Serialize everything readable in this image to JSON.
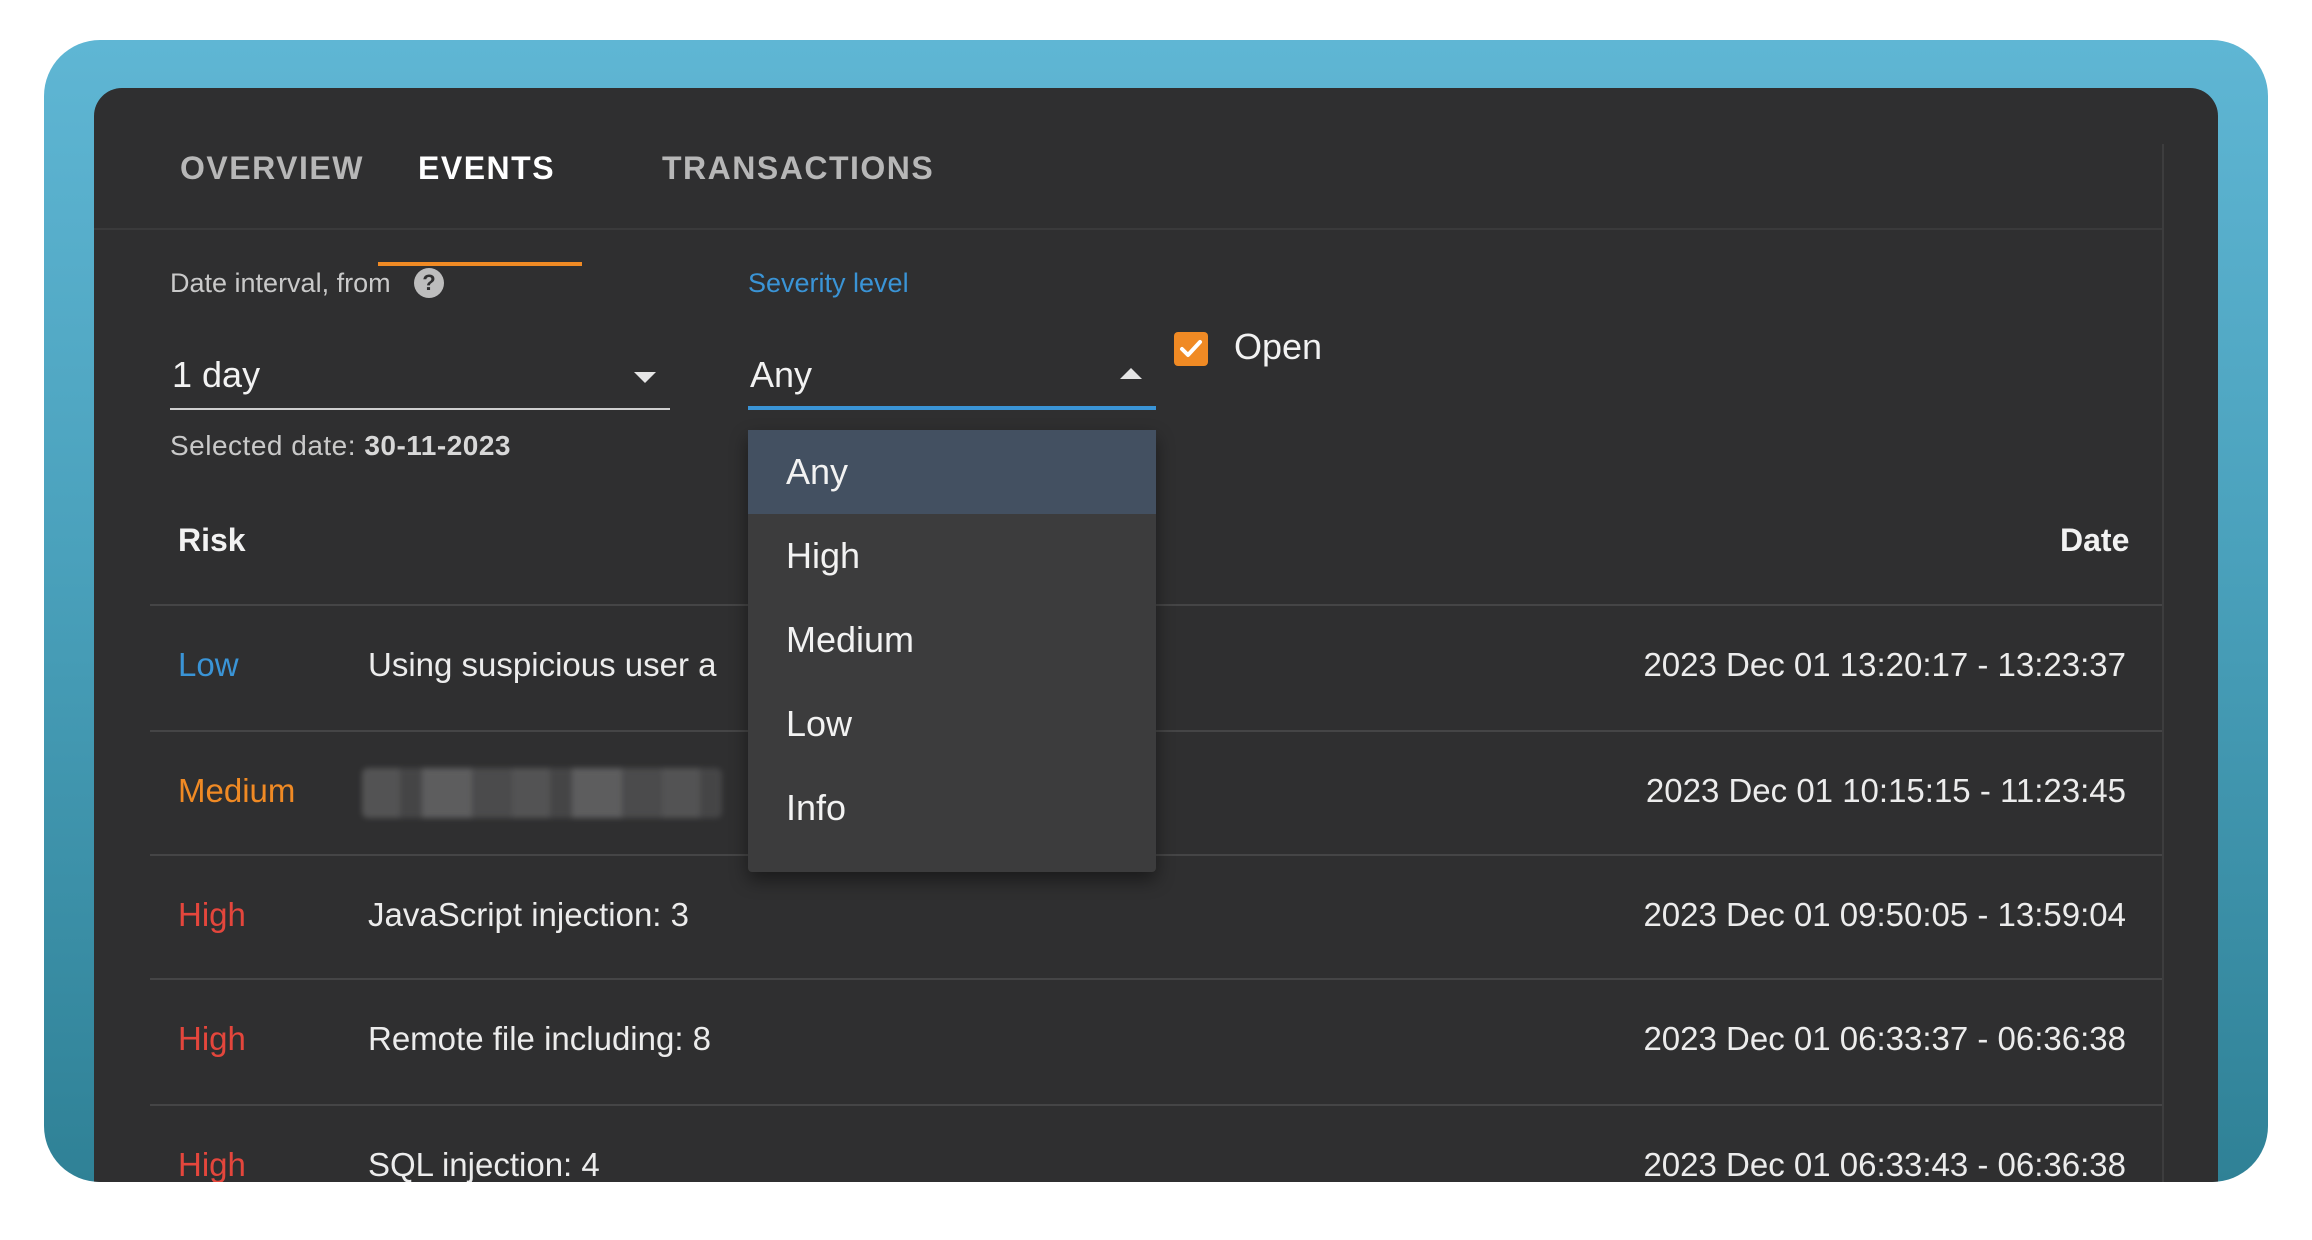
{
  "tabs": [
    {
      "label": "OVERVIEW",
      "active": false
    },
    {
      "label": "EVENTS",
      "active": true
    },
    {
      "label": "TRANSACTIONS",
      "active": false
    }
  ],
  "filters": {
    "date_interval": {
      "label": "Date interval, from",
      "value": "1 day",
      "help_icon": "help-circle-icon"
    },
    "severity": {
      "label": "Severity level",
      "value": "Any",
      "open": true
    },
    "open_checkbox": {
      "label": "Open",
      "checked": true
    },
    "selected_date": {
      "prefix": "Selected date:",
      "value": "30-11-2023"
    }
  },
  "severity_options": [
    {
      "label": "Any",
      "selected": true
    },
    {
      "label": "High",
      "selected": false
    },
    {
      "label": "Medium",
      "selected": false
    },
    {
      "label": "Low",
      "selected": false
    },
    {
      "label": "Info",
      "selected": false
    }
  ],
  "table": {
    "headers": {
      "risk": "Risk",
      "date": "Date"
    },
    "rows": [
      {
        "risk": "Low",
        "event": "Using suspicious user a",
        "date": "2023 Dec 01 13:20:17 - 13:23:37"
      },
      {
        "risk": "Medium",
        "event": "",
        "event_redacted": true,
        "date": "2023 Dec 01 10:15:15 - 11:23:45"
      },
      {
        "risk": "High",
        "event": "JavaScript injection: 3",
        "date": "2023 Dec 01 09:50:05 - 13:59:04"
      },
      {
        "risk": "High",
        "event": "Remote file including: 8",
        "date": "2023 Dec 01 06:33:37 - 06:36:38"
      },
      {
        "risk": "High",
        "event": "SQL injection: 4",
        "date": "2023 Dec 01 06:33:43 - 06:36:38"
      }
    ]
  },
  "colors": {
    "accent_orange": "#f08a24",
    "accent_blue": "#3a94d6",
    "risk_high": "#e4463c",
    "panel_bg": "#2f2f30",
    "frame_gradient_top": "#5fb6d4",
    "frame_gradient_bottom": "#2f8196"
  }
}
